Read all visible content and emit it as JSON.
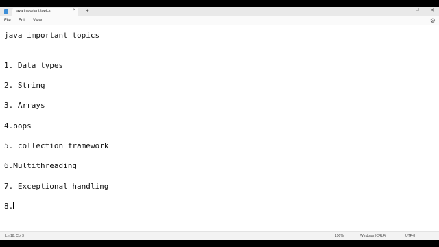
{
  "tab": {
    "title": "java important topics",
    "close": "×"
  },
  "new_tab": "+",
  "window_controls": {
    "minimize": "–",
    "maximize": "□",
    "close": "✕"
  },
  "menu": [
    "File",
    "Edit",
    "View"
  ],
  "settings_icon": "⚙",
  "editor": {
    "lines": [
      "java important topics",
      "1. Data types",
      "2. String",
      "3. Arrays",
      "4.oops",
      "5. collection framework",
      "6.Multithreading",
      "7. Exceptional handling",
      "8."
    ]
  },
  "status": {
    "position": "Ln 18, Col 3",
    "zoom": "100%",
    "line_ending": "Windows (CRLF)",
    "encoding": "UTF-8"
  }
}
